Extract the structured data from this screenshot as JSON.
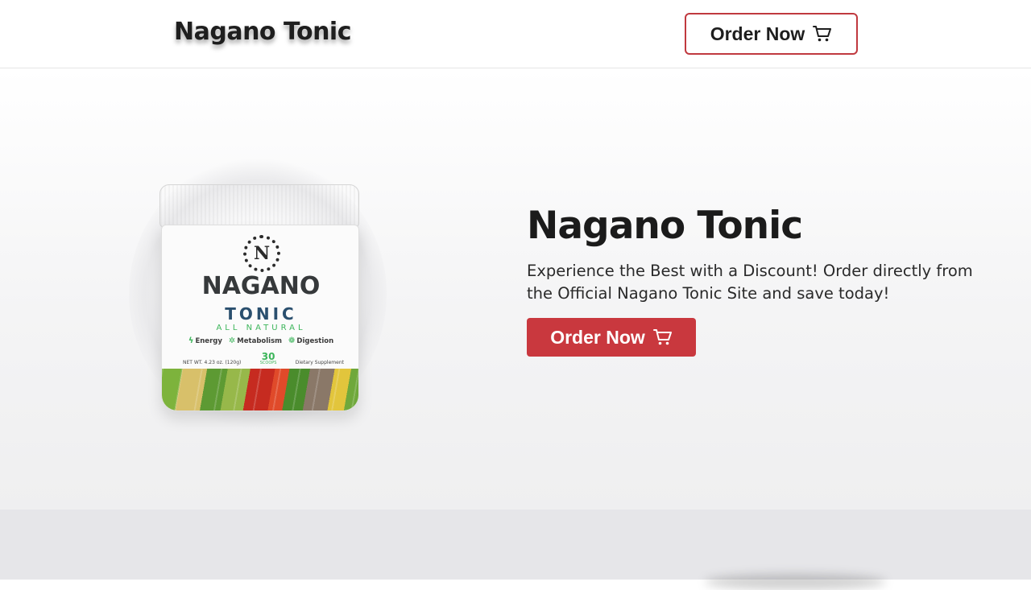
{
  "navbar": {
    "brand": "Nagano Tonic",
    "order_button": {
      "label": "Order Now",
      "icon": "cart-icon"
    }
  },
  "hero": {
    "title": "Nagano Tonic",
    "description": "Experience the Best with a Discount! Order directly from the Official Nagano Tonic Site and save today!",
    "order_button": {
      "label": "Order Now",
      "icon": "cart-icon"
    },
    "product": {
      "logo_letter": "N",
      "name": "NAGANO",
      "subname": "TONIC",
      "tagline": "ALL NATURAL",
      "benefits": [
        "Energy",
        "Metabolism",
        "Digestion"
      ],
      "net_weight": "NET WT. 4.23 oz. (120g)",
      "scoops_count": "30",
      "scoops_label": "SCOOPS",
      "supplement_label": "Dietary Supplement"
    }
  },
  "colors": {
    "accent": "#c9383e",
    "text": "#1b1b1b",
    "hero_bg": "#f4f4f5",
    "lower_bg": "#e6e6e9"
  }
}
